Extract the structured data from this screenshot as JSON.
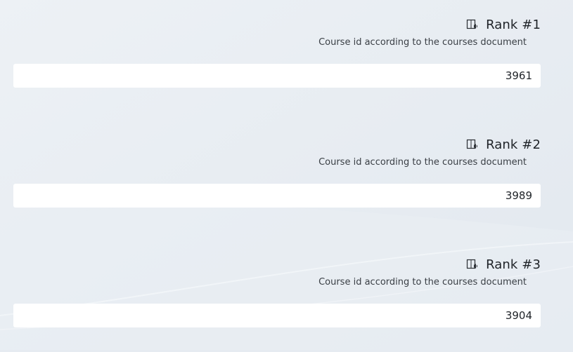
{
  "questions": [
    {
      "title": "Rank #1",
      "description": "Course id according to the courses document",
      "value": "3961",
      "icon": "audio-book-icon"
    },
    {
      "title": "Rank #2",
      "description": "Course id according to the courses document",
      "value": "3989",
      "icon": "audio-book-icon"
    },
    {
      "title": "Rank #3",
      "description": "Course id according to the courses document",
      "value": "3904",
      "icon": "audio-book-icon"
    }
  ],
  "colors": {
    "background": "#e6ebf1",
    "field": "#ffffff",
    "text": "#1f2328"
  }
}
